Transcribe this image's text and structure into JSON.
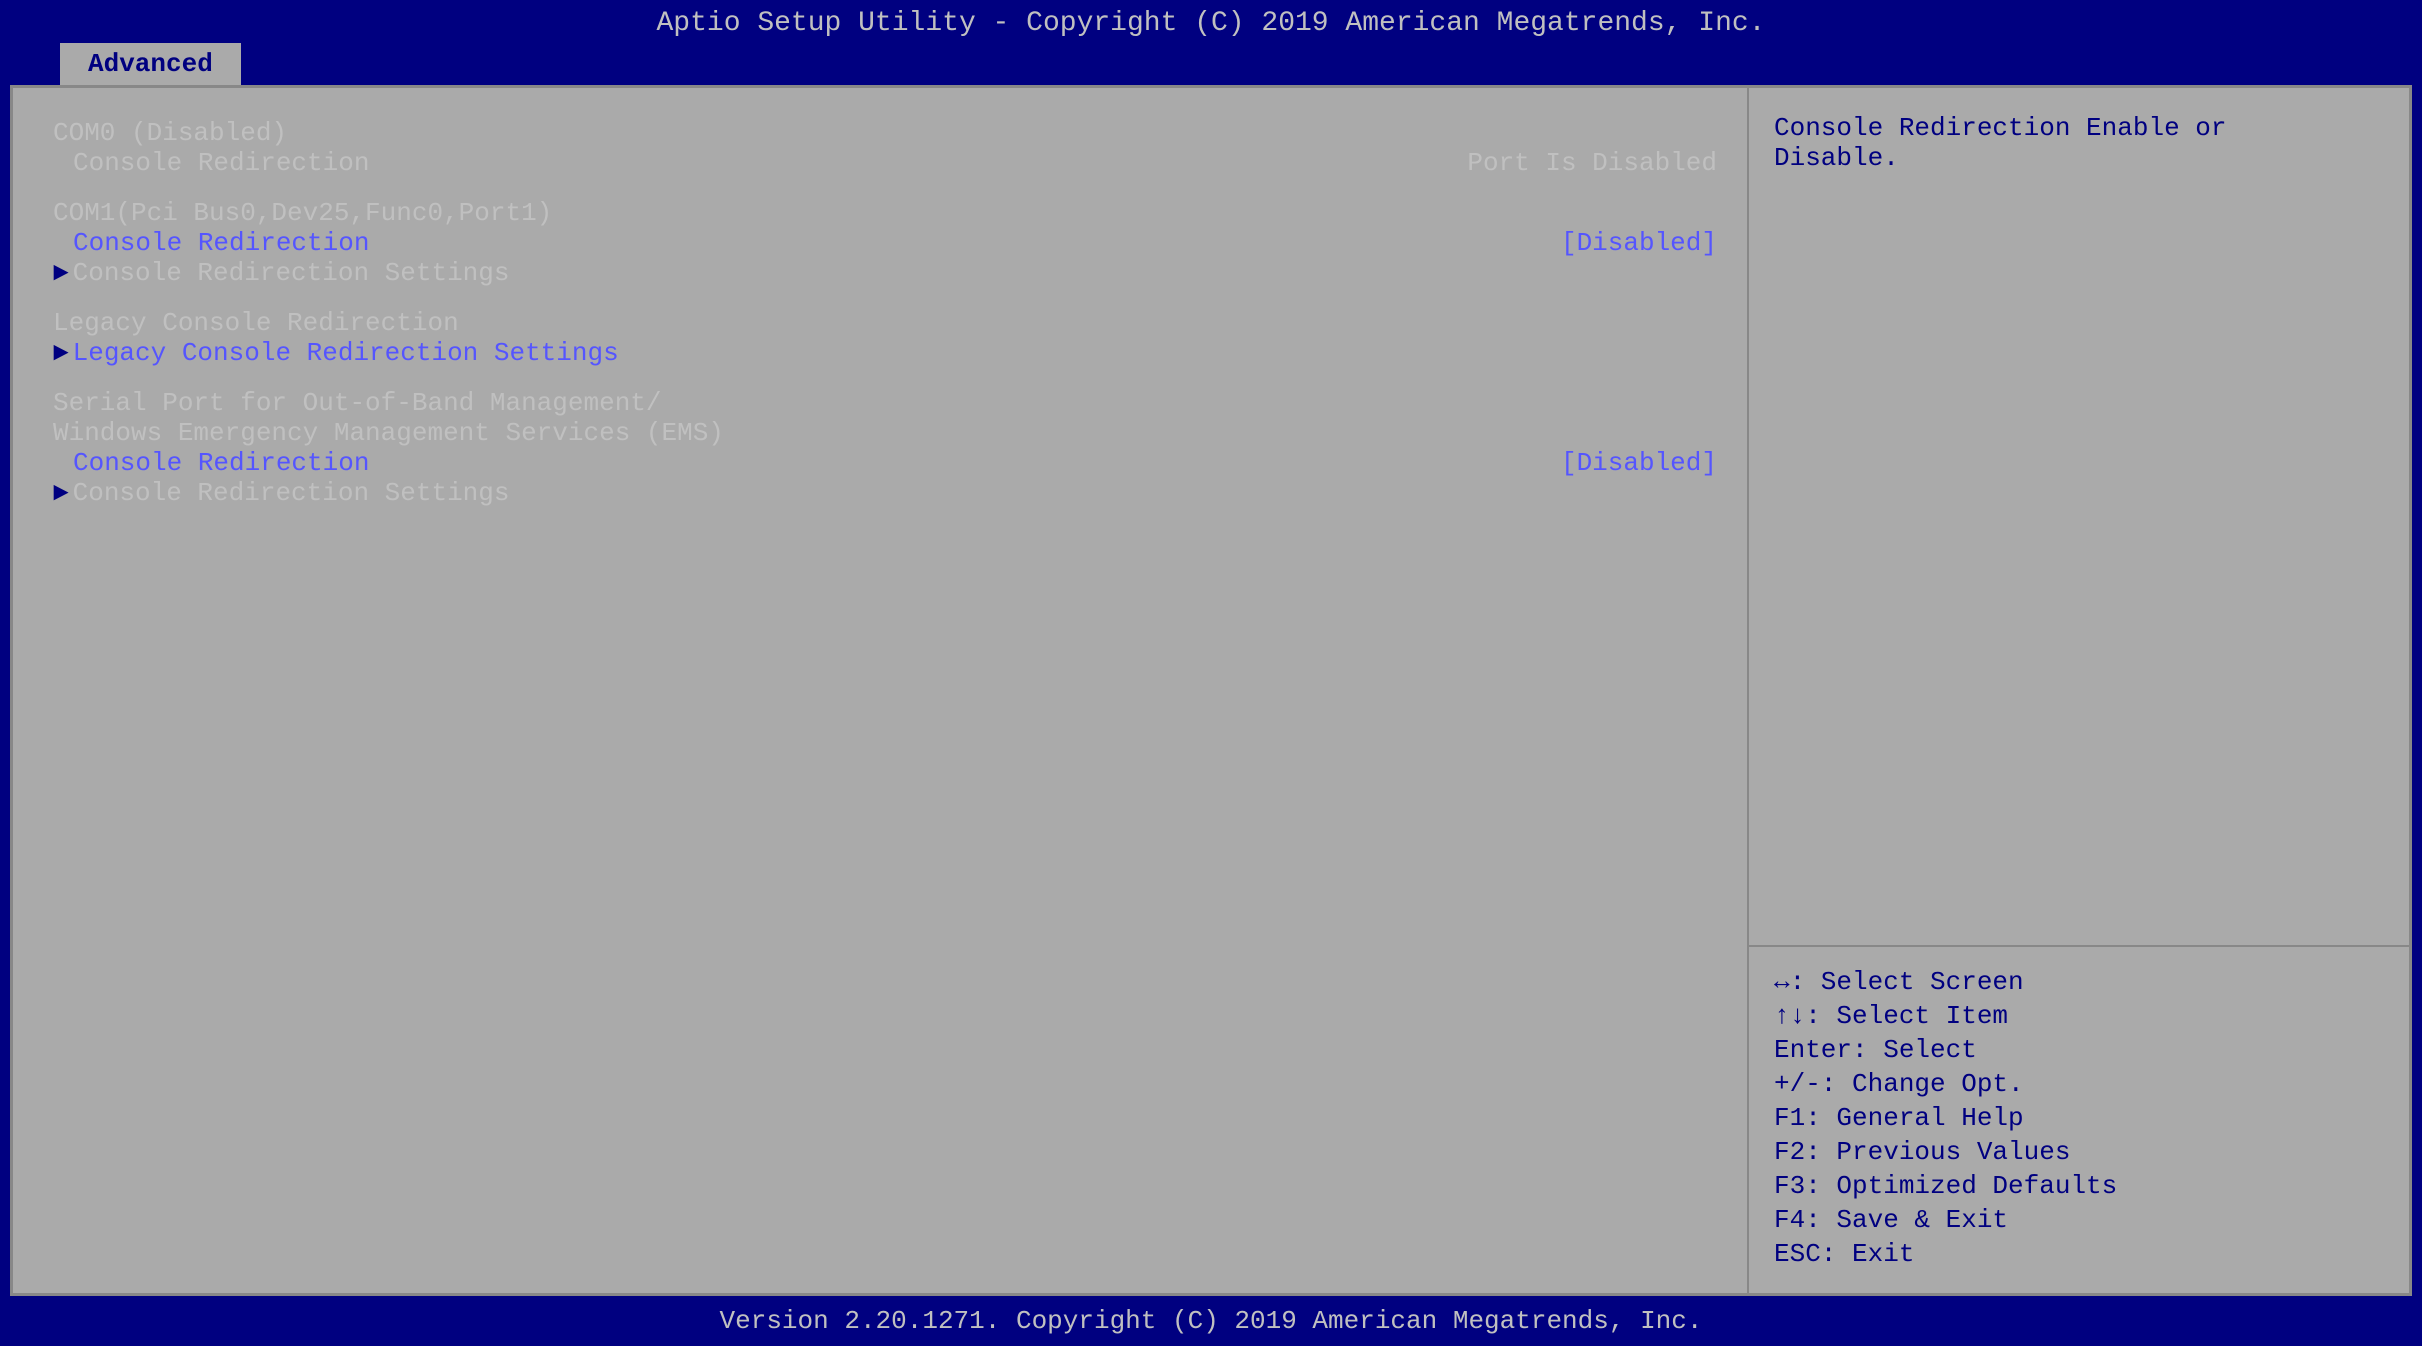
{
  "header": {
    "title": "Aptio Setup Utility - Copyright (C) 2019 American Megatrends, Inc."
  },
  "tab": {
    "label": "Advanced"
  },
  "left_panel": {
    "sections": [
      {
        "id": "com0",
        "header": "COM0 (Disabled)",
        "items": [
          {
            "label": "Console Redirection",
            "value": "Port Is Disabled",
            "is_link": false,
            "has_arrow": false,
            "is_submenu": false
          }
        ]
      },
      {
        "id": "com1",
        "header": "COM1(Pci Bus0,Dev25,Func0,Port1)",
        "items": [
          {
            "label": "Console Redirection",
            "value": "[Disabled]",
            "is_link": true,
            "has_arrow": false,
            "is_submenu": false
          },
          {
            "label": "Console Redirection Settings",
            "value": "",
            "is_link": false,
            "has_arrow": true,
            "is_submenu": true
          }
        ]
      },
      {
        "id": "legacy",
        "header": "Legacy Console Redirection",
        "items": [
          {
            "label": "Legacy Console Redirection Settings",
            "value": "",
            "is_link": true,
            "has_arrow": true,
            "is_submenu": true
          }
        ]
      },
      {
        "id": "serial",
        "header_line1": "Serial Port for Out-of-Band Management/",
        "header_line2": "Windows Emergency Management Services (EMS)",
        "items": [
          {
            "label": "Console Redirection",
            "value": "[Disabled]",
            "is_link": true,
            "has_arrow": false,
            "is_submenu": false
          },
          {
            "label": "Console Redirection Settings",
            "value": "",
            "is_link": false,
            "has_arrow": true,
            "is_submenu": true
          }
        ]
      }
    ]
  },
  "right_panel": {
    "help_text_line1": "Console Redirection Enable or",
    "help_text_line2": "Disable.",
    "keys": [
      {
        "key": "↔: Select Screen"
      },
      {
        "key": "↑↓: Select Item"
      },
      {
        "key": "Enter: Select"
      },
      {
        "key": "+/-: Change Opt."
      },
      {
        "key": "F1: General Help"
      },
      {
        "key": "F2: Previous Values"
      },
      {
        "key": "F3: Optimized Defaults"
      },
      {
        "key": "F4: Save & Exit"
      },
      {
        "key": "ESC: Exit"
      }
    ]
  },
  "footer": {
    "text": "Version 2.20.1271. Copyright (C) 2019 American Megatrends, Inc."
  }
}
